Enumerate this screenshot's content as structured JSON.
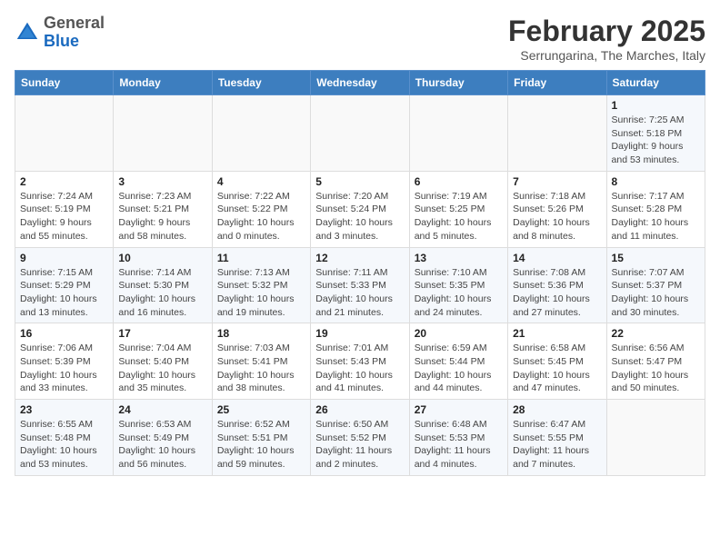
{
  "logo": {
    "general": "General",
    "blue": "Blue"
  },
  "header": {
    "month": "February 2025",
    "location": "Serrungarina, The Marches, Italy"
  },
  "weekdays": [
    "Sunday",
    "Monday",
    "Tuesday",
    "Wednesday",
    "Thursday",
    "Friday",
    "Saturday"
  ],
  "weeks": [
    [
      {
        "day": "",
        "detail": ""
      },
      {
        "day": "",
        "detail": ""
      },
      {
        "day": "",
        "detail": ""
      },
      {
        "day": "",
        "detail": ""
      },
      {
        "day": "",
        "detail": ""
      },
      {
        "day": "",
        "detail": ""
      },
      {
        "day": "1",
        "detail": "Sunrise: 7:25 AM\nSunset: 5:18 PM\nDaylight: 9 hours and 53 minutes."
      }
    ],
    [
      {
        "day": "2",
        "detail": "Sunrise: 7:24 AM\nSunset: 5:19 PM\nDaylight: 9 hours and 55 minutes."
      },
      {
        "day": "3",
        "detail": "Sunrise: 7:23 AM\nSunset: 5:21 PM\nDaylight: 9 hours and 58 minutes."
      },
      {
        "day": "4",
        "detail": "Sunrise: 7:22 AM\nSunset: 5:22 PM\nDaylight: 10 hours and 0 minutes."
      },
      {
        "day": "5",
        "detail": "Sunrise: 7:20 AM\nSunset: 5:24 PM\nDaylight: 10 hours and 3 minutes."
      },
      {
        "day": "6",
        "detail": "Sunrise: 7:19 AM\nSunset: 5:25 PM\nDaylight: 10 hours and 5 minutes."
      },
      {
        "day": "7",
        "detail": "Sunrise: 7:18 AM\nSunset: 5:26 PM\nDaylight: 10 hours and 8 minutes."
      },
      {
        "day": "8",
        "detail": "Sunrise: 7:17 AM\nSunset: 5:28 PM\nDaylight: 10 hours and 11 minutes."
      }
    ],
    [
      {
        "day": "9",
        "detail": "Sunrise: 7:15 AM\nSunset: 5:29 PM\nDaylight: 10 hours and 13 minutes."
      },
      {
        "day": "10",
        "detail": "Sunrise: 7:14 AM\nSunset: 5:30 PM\nDaylight: 10 hours and 16 minutes."
      },
      {
        "day": "11",
        "detail": "Sunrise: 7:13 AM\nSunset: 5:32 PM\nDaylight: 10 hours and 19 minutes."
      },
      {
        "day": "12",
        "detail": "Sunrise: 7:11 AM\nSunset: 5:33 PM\nDaylight: 10 hours and 21 minutes."
      },
      {
        "day": "13",
        "detail": "Sunrise: 7:10 AM\nSunset: 5:35 PM\nDaylight: 10 hours and 24 minutes."
      },
      {
        "day": "14",
        "detail": "Sunrise: 7:08 AM\nSunset: 5:36 PM\nDaylight: 10 hours and 27 minutes."
      },
      {
        "day": "15",
        "detail": "Sunrise: 7:07 AM\nSunset: 5:37 PM\nDaylight: 10 hours and 30 minutes."
      }
    ],
    [
      {
        "day": "16",
        "detail": "Sunrise: 7:06 AM\nSunset: 5:39 PM\nDaylight: 10 hours and 33 minutes."
      },
      {
        "day": "17",
        "detail": "Sunrise: 7:04 AM\nSunset: 5:40 PM\nDaylight: 10 hours and 35 minutes."
      },
      {
        "day": "18",
        "detail": "Sunrise: 7:03 AM\nSunset: 5:41 PM\nDaylight: 10 hours and 38 minutes."
      },
      {
        "day": "19",
        "detail": "Sunrise: 7:01 AM\nSunset: 5:43 PM\nDaylight: 10 hours and 41 minutes."
      },
      {
        "day": "20",
        "detail": "Sunrise: 6:59 AM\nSunset: 5:44 PM\nDaylight: 10 hours and 44 minutes."
      },
      {
        "day": "21",
        "detail": "Sunrise: 6:58 AM\nSunset: 5:45 PM\nDaylight: 10 hours and 47 minutes."
      },
      {
        "day": "22",
        "detail": "Sunrise: 6:56 AM\nSunset: 5:47 PM\nDaylight: 10 hours and 50 minutes."
      }
    ],
    [
      {
        "day": "23",
        "detail": "Sunrise: 6:55 AM\nSunset: 5:48 PM\nDaylight: 10 hours and 53 minutes."
      },
      {
        "day": "24",
        "detail": "Sunrise: 6:53 AM\nSunset: 5:49 PM\nDaylight: 10 hours and 56 minutes."
      },
      {
        "day": "25",
        "detail": "Sunrise: 6:52 AM\nSunset: 5:51 PM\nDaylight: 10 hours and 59 minutes."
      },
      {
        "day": "26",
        "detail": "Sunrise: 6:50 AM\nSunset: 5:52 PM\nDaylight: 11 hours and 2 minutes."
      },
      {
        "day": "27",
        "detail": "Sunrise: 6:48 AM\nSunset: 5:53 PM\nDaylight: 11 hours and 4 minutes."
      },
      {
        "day": "28",
        "detail": "Sunrise: 6:47 AM\nSunset: 5:55 PM\nDaylight: 11 hours and 7 minutes."
      },
      {
        "day": "",
        "detail": ""
      }
    ]
  ]
}
